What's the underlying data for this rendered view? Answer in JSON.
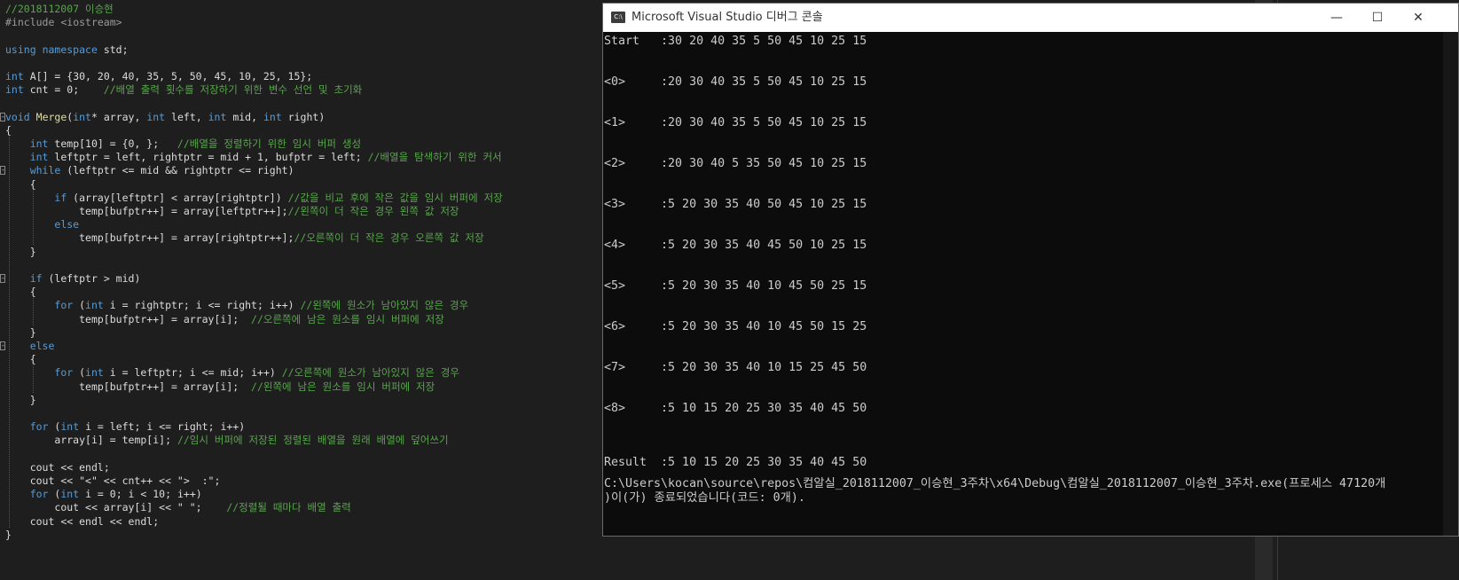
{
  "editor": {
    "lines": [
      "//2018112007 이승현",
      "#include <iostream>",
      "",
      "using namespace std;",
      "",
      "int A[] = {30, 20, 40, 35, 5, 50, 45, 10, 25, 15};",
      "int cnt = 0;    //배열 출력 횟수를 저장하기 위한 변수 선언 및 초기화",
      "",
      "void Merge(int* array, int left, int mid, int right)",
      "{",
      "    int temp[10] = {0, };   //배열을 정렬하기 위한 임시 버퍼 생성",
      "    int leftptr = left, rightptr = mid + 1, bufptr = left; //배열을 탐색하기 위한 커서",
      "    while (leftptr <= mid && rightptr <= right)",
      "    {",
      "        if (array[leftptr] < array[rightptr]) //값을 비교 후에 작은 값을 임시 버퍼에 저장",
      "            temp[bufptr++] = array[leftptr++];//왼쪽이 더 작은 경우 왼쪽 값 저장",
      "        else",
      "            temp[bufptr++] = array[rightptr++];//오른쪽이 더 작은 경우 오른쪽 값 저장",
      "    }",
      "",
      "    if (leftptr > mid)",
      "    {",
      "        for (int i = rightptr; i <= right; i++) //왼쪽에 원소가 남아있지 않은 경우",
      "            temp[bufptr++] = array[i];  //오른쪽에 남은 원소를 임시 버퍼에 저장",
      "    }",
      "    else",
      "    {",
      "        for (int i = leftptr; i <= mid; i++) //오른쪽에 원소가 남아있지 않은 경우",
      "            temp[bufptr++] = array[i];  //왼쪽에 남은 원소를 임시 버퍼에 저장",
      "    }",
      "",
      "    for (int i = left; i <= right; i++)",
      "        array[i] = temp[i]; //임시 버퍼에 저장된 정렬된 배열을 원래 배열에 덮어쓰기",
      "",
      "    cout << endl;",
      "    cout << \"<\" << cnt++ << \">  :\";",
      "    for (int i = 0; i < 10; i++)",
      "        cout << array[i] << \" \";    //정렬될 때마다 배열 출력",
      "    cout << endl << endl;",
      "}"
    ]
  },
  "console": {
    "title": "Microsoft Visual Studio 디버그 콘솔",
    "icon_label": "C:\\",
    "buttons": {
      "minimize": "—",
      "maximize": "☐",
      "close": "✕"
    },
    "lines": [
      {
        "text": "Start   :30 20 40 35 5 50 45 10 25 15",
        "row": 0
      },
      {
        "text": "<0>     :20 30 40 35 5 50 45 10 25 15",
        "row": 1
      },
      {
        "text": "<1>     :20 30 40 35 5 50 45 10 25 15",
        "row": 2
      },
      {
        "text": "<2>     :20 30 40 5 35 50 45 10 25 15",
        "row": 3
      },
      {
        "text": "<3>     :5 20 30 35 40 50 45 10 25 15",
        "row": 4
      },
      {
        "text": "<4>     :5 20 30 35 40 45 50 10 25 15",
        "row": 5
      },
      {
        "text": "<5>     :5 20 30 35 40 10 45 50 25 15",
        "row": 6
      },
      {
        "text": "<6>     :5 20 30 35 40 10 45 50 15 25",
        "row": 7
      },
      {
        "text": "<7>     :5 20 30 35 40 10 15 25 45 50",
        "row": 8
      },
      {
        "text": "<8>     :5 10 15 20 25 30 35 40 45 50",
        "row": 9
      },
      {
        "text": "Result  :5 10 15 20 25 30 35 40 45 50",
        "row": 10
      },
      {
        "text": "C:\\Users\\kocan\\source\\repos\\컴알실_2018112007_이승현_3주차\\x64\\Debug\\컴알실_2018112007_이승현_3주차.exe(프로세스 47120개",
        "row": 11
      },
      {
        "text": ")이(가) 종료되었습니다(코드: 0개).",
        "row": 12
      }
    ]
  }
}
